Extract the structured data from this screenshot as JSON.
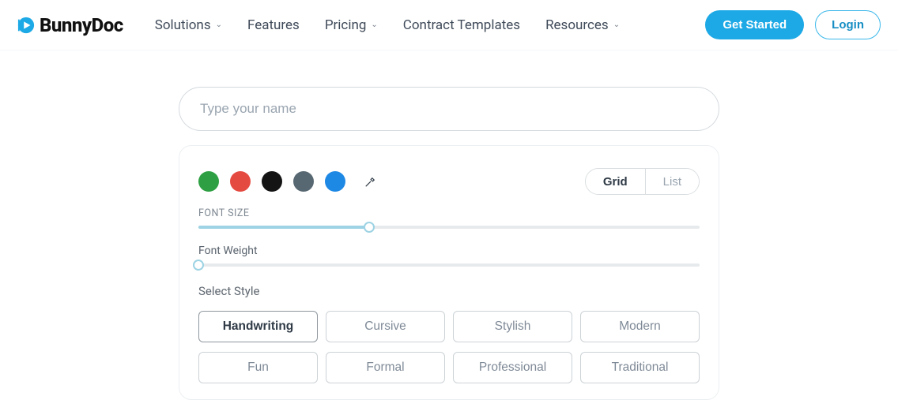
{
  "header": {
    "logo_text": "BunnyDoc",
    "nav": {
      "solutions": "Solutions",
      "features": "Features",
      "pricing": "Pricing",
      "contract_templates": "Contract Templates",
      "resources": "Resources"
    },
    "get_started": "Get Started",
    "login": "Login"
  },
  "main": {
    "name_placeholder": "Type your name",
    "colors": [
      "#2ea043",
      "#e54a41",
      "#141414",
      "#586872",
      "#1e88e5"
    ],
    "view_toggle": {
      "grid": "Grid",
      "list": "List",
      "active": "grid"
    },
    "font_size": {
      "label": "FONT SIZE",
      "value": 34,
      "min": 0,
      "max": 100
    },
    "font_weight": {
      "label": "Font Weight",
      "value": 0,
      "min": 0,
      "max": 100
    },
    "select_style_label": "Select Style",
    "styles": {
      "handwriting": "Handwriting",
      "cursive": "Cursive",
      "stylish": "Stylish",
      "modern": "Modern",
      "fun": "Fun",
      "formal": "Formal",
      "professional": "Professional",
      "traditional": "Traditional"
    },
    "selected_style": "handwriting"
  }
}
